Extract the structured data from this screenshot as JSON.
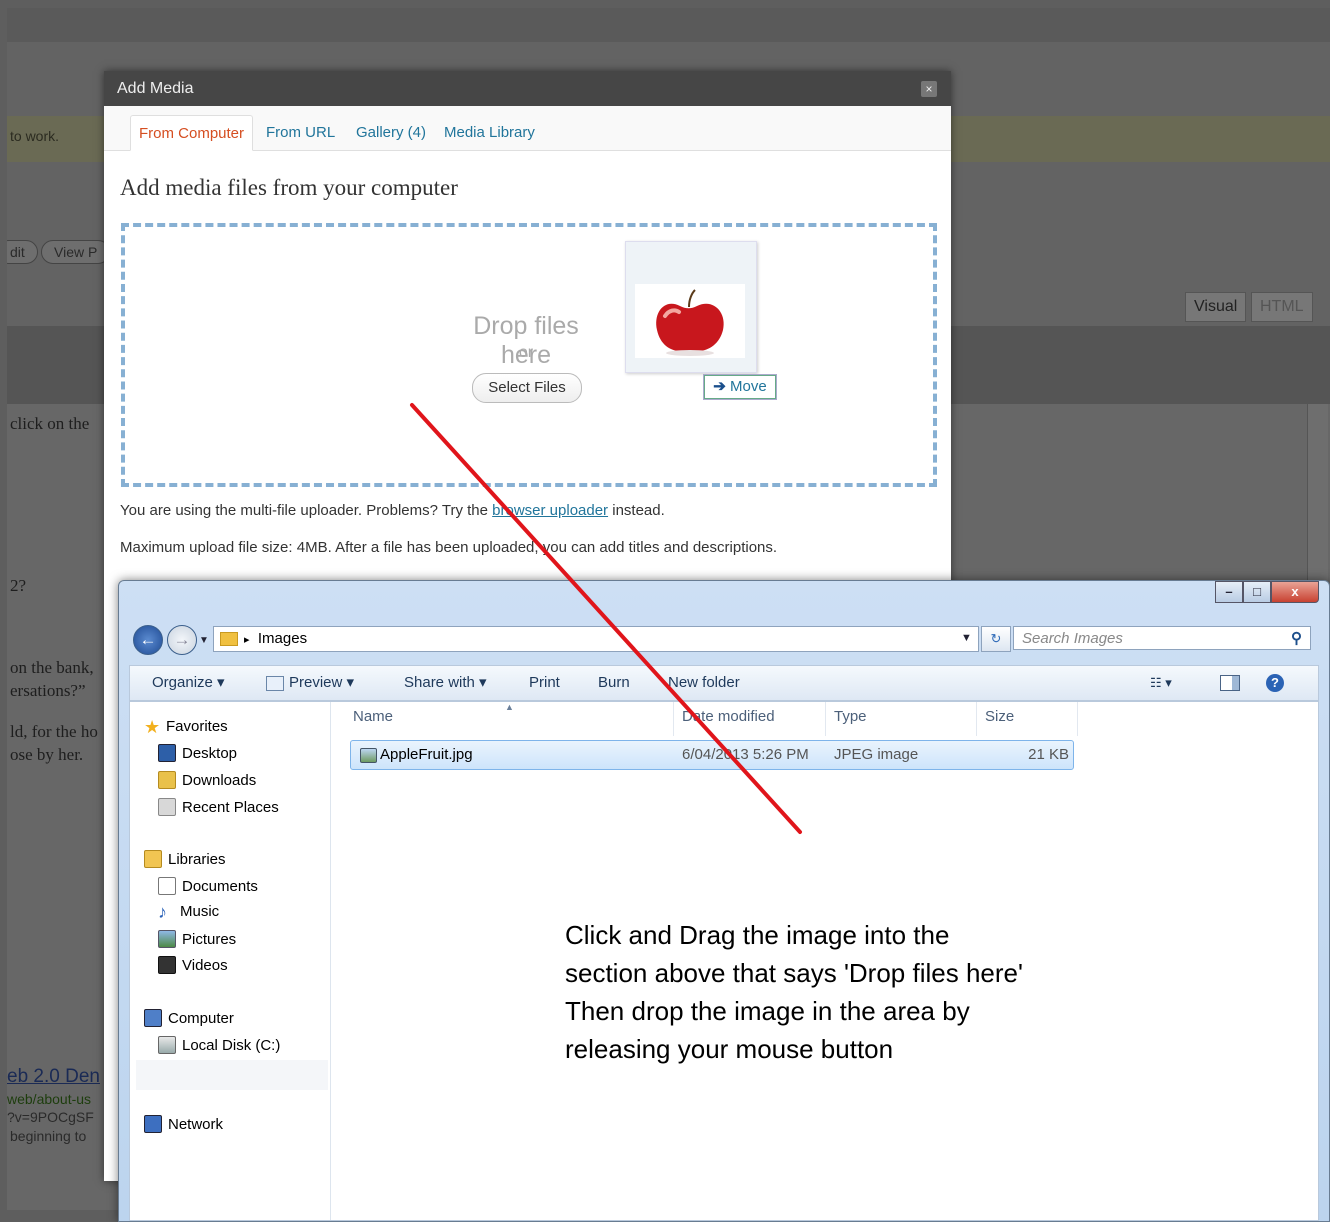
{
  "background": {
    "notice_text": "to work.",
    "buttons": [
      "dit",
      "View P"
    ],
    "editor_tabs": [
      "Visual",
      "HTML"
    ],
    "text_lines": [
      "click on the",
      "2?",
      "on the bank,",
      "ersations?”",
      "ld, for the ho",
      "ose by her.",
      "eb 2.0 Den",
      "web/about-us",
      "?v=9POCgSF",
      "beginning to"
    ]
  },
  "dialog": {
    "title": "Add Media",
    "close_label": "×",
    "tabs": [
      {
        "label": "From Computer",
        "active": true
      },
      {
        "label": "From URL",
        "active": false
      },
      {
        "label": "Gallery (4)",
        "active": false
      },
      {
        "label": "Media Library",
        "active": false
      }
    ],
    "heading": "Add media files from your computer",
    "drop_text": "Drop files here",
    "or_text": "or",
    "select_button": "Select Files",
    "move_label": "Move",
    "info_prefix": "You are using the multi-file uploader. Problems? Try the ",
    "info_link": "browser uploader",
    "info_suffix": " instead.",
    "max_size_text": "Maximum upload file size: 4MB. After a file has been uploaded, you can add titles and descriptions."
  },
  "explorer": {
    "window_buttons": {
      "minimize": "–",
      "maximize": "□",
      "close": "x"
    },
    "address": {
      "separator": "▸",
      "folder": "Images"
    },
    "search_placeholder": "Search Images",
    "toolbar": {
      "organize": "Organize ▾",
      "preview": "Preview ▾",
      "share": "Share with ▾",
      "print": "Print",
      "burn": "Burn",
      "new_folder": "New folder"
    },
    "nav": {
      "favorites": "Favorites",
      "desktop": "Desktop",
      "downloads": "Downloads",
      "recent": "Recent Places",
      "libraries": "Libraries",
      "documents": "Documents",
      "music": "Music",
      "pictures": "Pictures",
      "videos": "Videos",
      "computer": "Computer",
      "local_disk": "Local Disk (C:)",
      "network": "Network"
    },
    "columns": {
      "name": "Name",
      "date": "Date modified",
      "type": "Type",
      "size": "Size"
    },
    "files": [
      {
        "name": "AppleFruit.jpg",
        "date": "6/04/2013 5:26 PM",
        "type": "JPEG image",
        "size": "21 KB"
      }
    ]
  },
  "annotation": {
    "lines": [
      "Click and Drag the image into the",
      "section above that says 'Drop files here'",
      "Then drop the image in the area by",
      "releasing your mouse button"
    ]
  },
  "colors": {
    "drag_line": "#e0151b",
    "link": "#21759b",
    "active_tab": "#d54e21",
    "drop_border": "#87b0d3"
  }
}
